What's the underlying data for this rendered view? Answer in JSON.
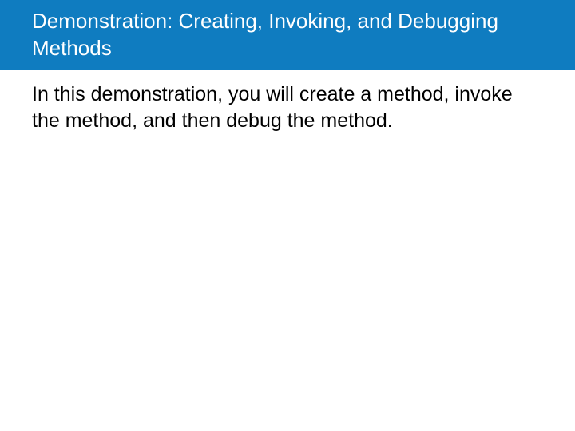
{
  "header": {
    "title": "Demonstration: Creating, Invoking, and Debugging Methods"
  },
  "content": {
    "paragraph": "In this demonstration, you will create a method, invoke the method, and then debug the method."
  }
}
